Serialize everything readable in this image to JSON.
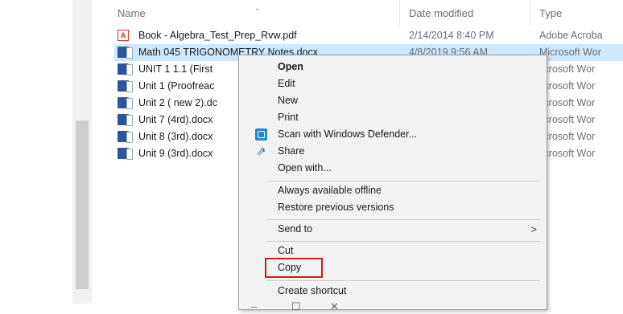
{
  "columns": {
    "name": "Name",
    "date": "Date modified",
    "type": "Type"
  },
  "files": [
    {
      "name": "Book - Algebra_Test_Prep_Rvw.pdf",
      "date": "2/14/2014 8:40 PM",
      "type": "Adobe Acroba",
      "icon": "pdf-icon"
    },
    {
      "name": "Math 045 TRIGONOMETRY Notes.docx",
      "date": "4/8/2019 9:56 AM",
      "type": "Microsoft Wor",
      "icon": "word-doc-icon"
    },
    {
      "name": "UNIT 1   1.1 (First",
      "date": "",
      "type": "licrosoft Wor",
      "icon": "word-doc-icon"
    },
    {
      "name": "Unit 1 (Proofreac",
      "date": "",
      "type": "licrosoft Wor",
      "icon": "word-doc-icon"
    },
    {
      "name": "Unit 2 ( new 2).dc",
      "date": "",
      "type": "licrosoft Wor",
      "icon": "word-doc-icon"
    },
    {
      "name": "Unit 7 (4rd).docx",
      "date": "",
      "type": "licrosoft Wor",
      "icon": "word-doc-icon"
    },
    {
      "name": "Unit 8 (3rd).docx",
      "date": "",
      "type": "licrosoft Wor",
      "icon": "word-doc-icon"
    },
    {
      "name": "Unit 9 (3rd).docx",
      "date": "",
      "type": "licrosoft Wor",
      "icon": "word-doc-icon"
    }
  ],
  "context_menu": {
    "open": "Open",
    "edit": "Edit",
    "new": "New",
    "print": "Print",
    "scan": "Scan with Windows Defender...",
    "share": "Share",
    "open_with": "Open with...",
    "offline": "Always available offline",
    "restore": "Restore previous versions",
    "send_to": "Send to",
    "send_to_arrow": ">",
    "cut": "Cut",
    "copy": "Copy",
    "create_shortcut": "Create shortcut"
  },
  "window_controls": {
    "minimize": "–",
    "maximize": "☐",
    "close": "✕"
  },
  "colors": {
    "selection": "#cce8ff",
    "highlight_box": "#d11a1a",
    "menu_bg": "#f2f2f2"
  }
}
